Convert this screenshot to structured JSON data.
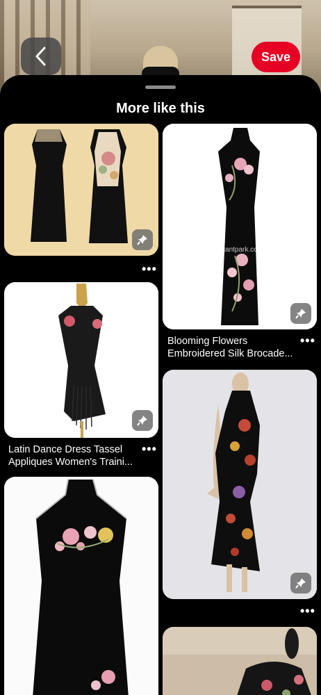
{
  "header": {
    "save_label": "Save"
  },
  "sheet": {
    "title": "More like this"
  },
  "pins": [
    {
      "caption_line1": "",
      "caption_line2": ""
    },
    {
      "caption_line1": "Blooming Flowers",
      "caption_line2": "Embroidered Silk Brocade...",
      "watermark": "Elegantpark.com"
    },
    {
      "caption_line1": "Latin Dance Dress Tassel",
      "caption_line2": "Appliques Women's Traini..."
    },
    {
      "caption_line1": "",
      "caption_line2": ""
    },
    {
      "caption_line1": "",
      "caption_line2": ""
    },
    {
      "caption_line1": "",
      "caption_line2": ""
    }
  ],
  "more_label": "•••",
  "colors": {
    "save_red": "#e60023",
    "sheet_bg": "#000000"
  },
  "icons": [
    "back-arrow-icon",
    "pin-save-icon",
    "more-dots-icon"
  ]
}
